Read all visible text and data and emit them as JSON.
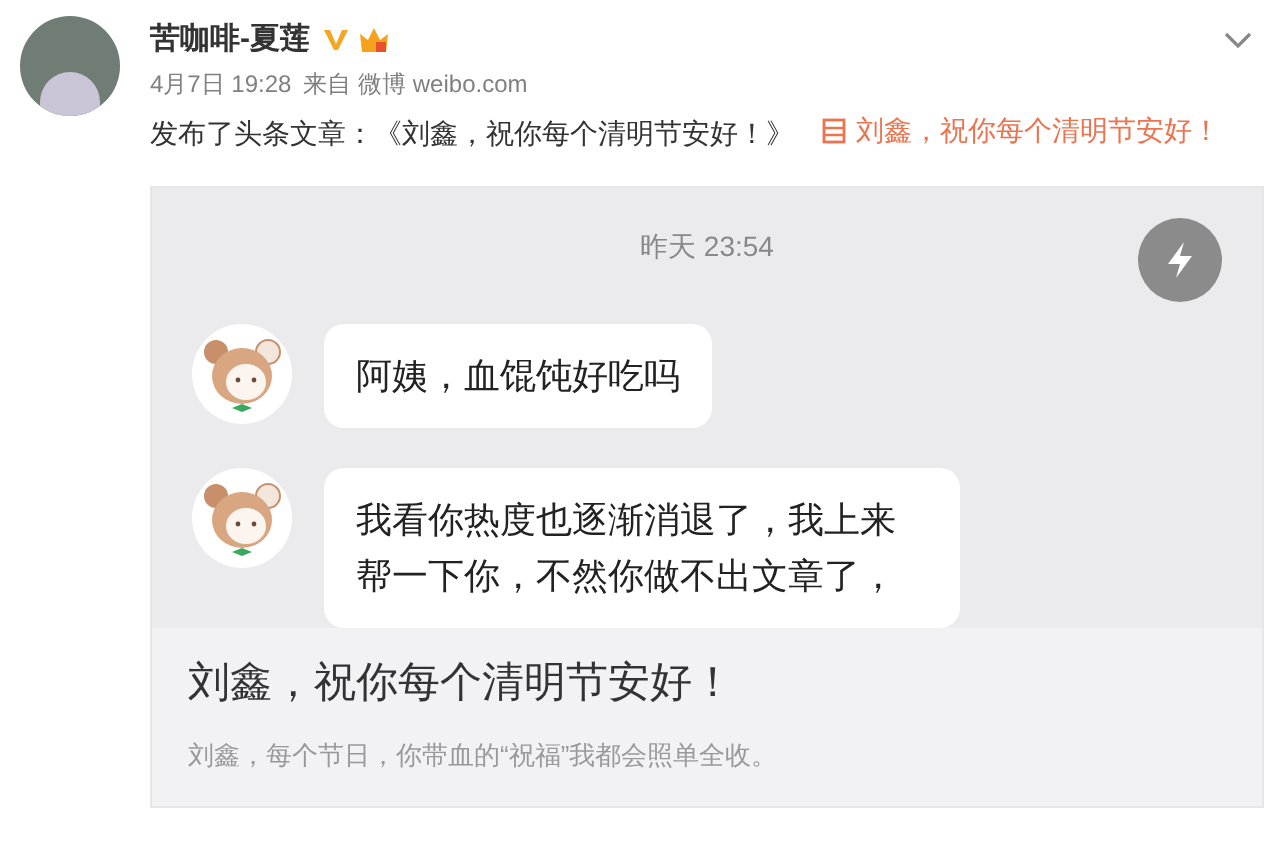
{
  "post": {
    "author": "苦咖啡-夏莲",
    "date": "4月7日 19:28",
    "source": "来自 微博 weibo.com",
    "text": "发布了头条文章：《刘鑫，祝你每个清明节安好！》",
    "link": "刘鑫，祝你每个清明节安好！"
  },
  "card": {
    "chat_time": "昨天 23:54",
    "messages": [
      {
        "text": "阿姨，血馄饨好吃吗"
      },
      {
        "text": "我看你热度也逐渐消退了，我上来帮一下你，不然你做不出文章了，"
      }
    ],
    "title": "刘鑫，祝你每个清明节安好！",
    "summary": "刘鑫，每个节日，你带血的“祝福”我都会照单全收。"
  }
}
